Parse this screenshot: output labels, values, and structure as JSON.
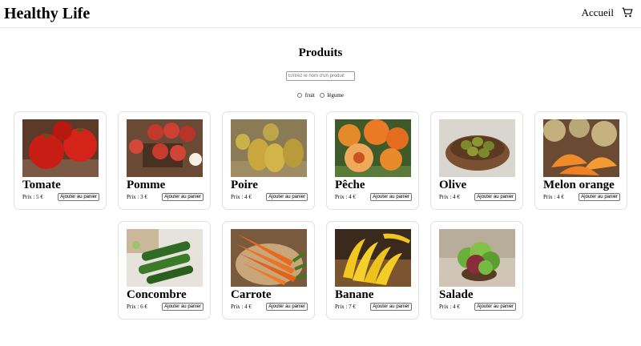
{
  "header": {
    "brand": "Healthy Life",
    "nav_home": "Accueil",
    "cart_icon": "cart-icon"
  },
  "page": {
    "title": "Produits",
    "search_placeholder": "Entrez le nom d'un produit",
    "filters": [
      "fruit",
      "légume"
    ]
  },
  "products": [
    {
      "name": "Tomate",
      "price": "Prix : 5 €",
      "button": "Ajouter au panier"
    },
    {
      "name": "Pomme",
      "price": "Prix : 3 €",
      "button": "Ajouter au panier"
    },
    {
      "name": "Poire",
      "price": "Prix : 4 €",
      "button": "Ajouter au panier"
    },
    {
      "name": "Pêche",
      "price": "Prix : 4 €",
      "button": "Ajouter au panier"
    },
    {
      "name": "Olive",
      "price": "Prix : 4 €",
      "button": "Ajouter au panier"
    },
    {
      "name": "Melon orange",
      "price": "Prix : 4 €",
      "button": "Ajouter au panier"
    },
    {
      "name": "Concombre",
      "price": "Prix : 6 €",
      "button": "Ajouter au panier"
    },
    {
      "name": "Carrote",
      "price": "Prix : 4 €",
      "button": "Ajouter au panier"
    },
    {
      "name": "Banane",
      "price": "Prix : 7 €",
      "button": "Ajouter au panier"
    },
    {
      "name": "Salade",
      "price": "Prix : 4 €",
      "button": "Ajouter au panier"
    }
  ]
}
